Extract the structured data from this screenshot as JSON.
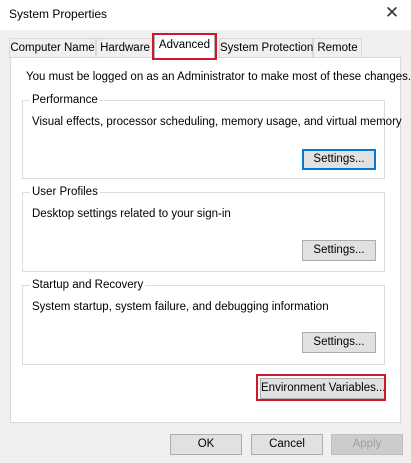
{
  "window": {
    "title": "System Properties",
    "close_glyph": "✕"
  },
  "tabs": [
    {
      "label": "Computer Name"
    },
    {
      "label": "Hardware"
    },
    {
      "label": "Advanced",
      "selected": true
    },
    {
      "label": "System Protection"
    },
    {
      "label": "Remote"
    }
  ],
  "advanced": {
    "admin_note": "You must be logged on as an Administrator to make most of these changes.",
    "performance": {
      "title": "Performance",
      "description": "Visual effects, processor scheduling, memory usage, and virtual memory",
      "button": "Settings..."
    },
    "user_profiles": {
      "title": "User Profiles",
      "description": "Desktop settings related to your sign-in",
      "button": "Settings..."
    },
    "startup_recovery": {
      "title": "Startup and Recovery",
      "description": "System startup, system failure, and debugging information",
      "button": "Settings..."
    },
    "env_button": "Environment Variables..."
  },
  "footer": {
    "ok": "OK",
    "cancel": "Cancel",
    "apply": "Apply"
  },
  "colors": {
    "highlight": "#d1182a",
    "focus": "#0078d7"
  }
}
